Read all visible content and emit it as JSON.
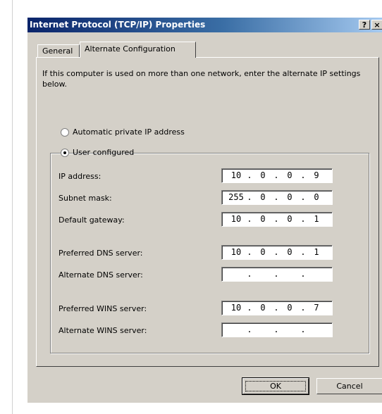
{
  "window": {
    "title": "Internet Protocol (TCP/IP) Properties",
    "help_button": "?",
    "close_button": "×"
  },
  "tabs": [
    {
      "label": "General",
      "selected": false
    },
    {
      "label": "Alternate Configuration",
      "selected": true
    }
  ],
  "intro_text": "If this computer is used on more than one network, enter the alternate IP settings below.",
  "options": {
    "automatic": {
      "label": "Automatic private IP address",
      "selected": false
    },
    "user": {
      "label": "User configured",
      "selected": true
    }
  },
  "fields": [
    {
      "label": "IP address:",
      "value": [
        "10",
        "0",
        "0",
        "9"
      ]
    },
    {
      "label": "Subnet mask:",
      "value": [
        "255",
        "0",
        "0",
        "0"
      ]
    },
    {
      "label": "Default gateway:",
      "value": [
        "10",
        "0",
        "0",
        "1"
      ]
    },
    {
      "label": "Preferred DNS server:",
      "value": [
        "10",
        "0",
        "0",
        "1"
      ]
    },
    {
      "label": "Alternate DNS server:",
      "value": [
        "",
        "",
        "",
        ""
      ]
    },
    {
      "label": "Preferred WINS server:",
      "value": [
        "10",
        "0",
        "0",
        "7"
      ]
    },
    {
      "label": "Alternate WINS server:",
      "value": [
        "",
        "",
        "",
        ""
      ]
    }
  ],
  "buttons": {
    "ok": "OK",
    "cancel": "Cancel"
  },
  "colors": {
    "dialog_face": "#d4d0c8",
    "title_start": "#0a246a",
    "title_end": "#a6caf0"
  }
}
